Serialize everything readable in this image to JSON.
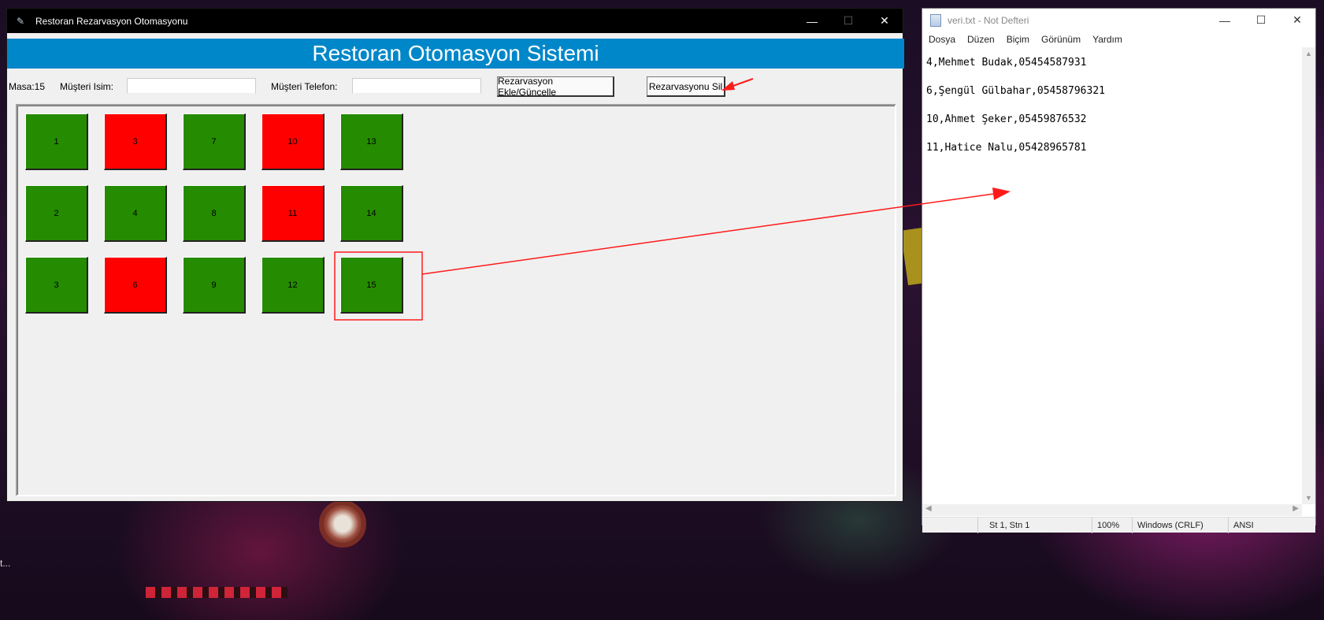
{
  "background": {
    "left_edge_text": "t..."
  },
  "tk_app": {
    "window_title": "Restoran Rezarvasyon Otomasyonu",
    "icons": {
      "app": "feather-icon",
      "minimize": "minimize-icon",
      "maximize": "maximize-icon",
      "close": "close-icon"
    },
    "header_title": "Restoran Otomasyon Sistemi",
    "header_color": "#0087c9",
    "form": {
      "masa_label": "Masa:15",
      "customer_name_label": "Müşteri Isim:",
      "customer_name_value": "",
      "customer_phone_label": "Müşteri Telefon:",
      "customer_phone_value": "",
      "add_update_button": "Rezarvasyon Ekle/Güncelle",
      "delete_button": "Rezarvasyonu Sil"
    },
    "status_colors": {
      "free": "#258b00",
      "reserved": "#ff0000"
    },
    "tables": [
      {
        "label": "1",
        "status": "free"
      },
      {
        "label": "3",
        "status": "reserved"
      },
      {
        "label": "7",
        "status": "free"
      },
      {
        "label": "10",
        "status": "reserved"
      },
      {
        "label": "13",
        "status": "free"
      },
      {
        "label": "2",
        "status": "free"
      },
      {
        "label": "4",
        "status": "free"
      },
      {
        "label": "8",
        "status": "free"
      },
      {
        "label": "11",
        "status": "reserved"
      },
      {
        "label": "14",
        "status": "free"
      },
      {
        "label": "3",
        "status": "free"
      },
      {
        "label": "6",
        "status": "reserved"
      },
      {
        "label": "9",
        "status": "free"
      },
      {
        "label": "12",
        "status": "free"
      },
      {
        "label": "15",
        "status": "free"
      }
    ]
  },
  "notepad": {
    "window_title": "veri.txt - Not Defteri",
    "icons": {
      "doc": "notepad-icon",
      "minimize": "minimize-icon",
      "maximize": "maximize-icon",
      "close": "close-icon"
    },
    "menu": [
      "Dosya",
      "Düzen",
      "Biçim",
      "Görünüm",
      "Yardım"
    ],
    "lines": [
      "4,Mehmet Budak,05454587931",
      "6,Şengül Gülbahar,05458796321",
      "10,Ahmet Şeker,05459876532",
      "11,Hatice Nalu,05428965781"
    ],
    "status": {
      "position": "St 1, Stn 1",
      "zoom": "100%",
      "line_ending": "Windows (CRLF)",
      "encoding": "ANSI"
    }
  },
  "annotation_color": "#ff1a1a"
}
